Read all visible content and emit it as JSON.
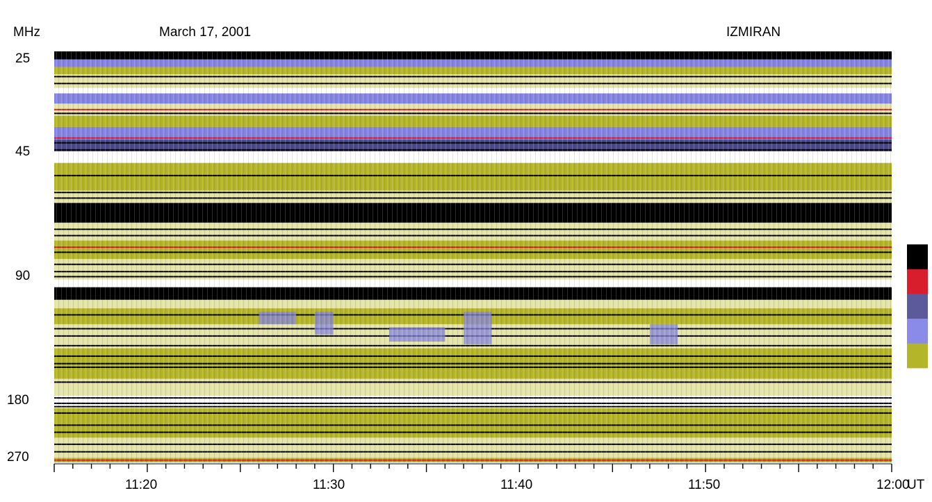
{
  "chart_data": {
    "type": "heatmap",
    "subtype": "radio-spectrogram",
    "date": "March 17, 2001",
    "observatory": "IZMIRAN",
    "ylabel": "MHz",
    "xlabel": "UT",
    "y_ticks": [
      "25",
      "45",
      "90",
      "180",
      "270"
    ],
    "x_ticks": [
      "11:20",
      "11:30",
      "11:40",
      "11:50",
      "12:00"
    ],
    "y_scale": "log",
    "y_range_mhz": [
      25,
      270
    ],
    "x_range": [
      "11:15",
      "12:00"
    ],
    "colorbar_colors": [
      "#000000",
      "#d81e2c",
      "#5c5a9a",
      "#8a8ae8",
      "#b5b52a",
      "#ffffff"
    ],
    "palette": {
      "black": "#000000",
      "red": "#d81e2c",
      "dark_blue": "#4c4a8a",
      "blue": "#8484e2",
      "olive": "#b5b52a",
      "light_yellow": "#e4e3a8",
      "white": "#ffffff"
    },
    "bands": [
      {
        "from_mhz": 25,
        "to_mhz": 26.2,
        "level": "black"
      },
      {
        "from_mhz": 26.2,
        "to_mhz": 27.4,
        "level": "blue"
      },
      {
        "from_mhz": 27.4,
        "to_mhz": 28.6,
        "level": "olive"
      },
      {
        "from_mhz": 28.6,
        "to_mhz": 31.0,
        "level": "light_yellow"
      },
      {
        "from_mhz": 31.0,
        "to_mhz": 32.0,
        "level": "white"
      },
      {
        "from_mhz": 32.0,
        "to_mhz": 34.0,
        "level": "blue"
      },
      {
        "from_mhz": 34.0,
        "to_mhz": 36.5,
        "level": "light_yellow"
      },
      {
        "from_mhz": 36.5,
        "to_mhz": 39.0,
        "level": "olive"
      },
      {
        "from_mhz": 39.0,
        "to_mhz": 42.0,
        "level": "blue"
      },
      {
        "from_mhz": 42.0,
        "to_mhz": 45.0,
        "level": "dark_blue"
      },
      {
        "from_mhz": 45.0,
        "to_mhz": 48.0,
        "level": "white"
      },
      {
        "from_mhz": 48.0,
        "to_mhz": 56.0,
        "level": "olive"
      },
      {
        "from_mhz": 56.0,
        "to_mhz": 60.0,
        "level": "light_yellow"
      },
      {
        "from_mhz": 60.0,
        "to_mhz": 67.0,
        "level": "black"
      },
      {
        "from_mhz": 67.0,
        "to_mhz": 74.0,
        "level": "light_yellow"
      },
      {
        "from_mhz": 74.0,
        "to_mhz": 82.0,
        "level": "olive"
      },
      {
        "from_mhz": 82.0,
        "to_mhz": 92.0,
        "level": "light_yellow"
      },
      {
        "from_mhz": 92.0,
        "to_mhz": 96.0,
        "level": "white"
      },
      {
        "from_mhz": 96.0,
        "to_mhz": 103.0,
        "level": "black"
      },
      {
        "from_mhz": 103.0,
        "to_mhz": 108.0,
        "level": "light_yellow"
      },
      {
        "from_mhz": 108.0,
        "to_mhz": 118.0,
        "level": "olive"
      },
      {
        "from_mhz": 118.0,
        "to_mhz": 135.0,
        "level": "light_yellow"
      },
      {
        "from_mhz": 135.0,
        "to_mhz": 160.0,
        "level": "olive"
      },
      {
        "from_mhz": 160.0,
        "to_mhz": 176.0,
        "level": "light_yellow"
      },
      {
        "from_mhz": 176.0,
        "to_mhz": 190.0,
        "level": "white"
      },
      {
        "from_mhz": 190.0,
        "to_mhz": 230.0,
        "level": "olive"
      },
      {
        "from_mhz": 230.0,
        "to_mhz": 262.0,
        "level": "light_yellow"
      },
      {
        "from_mhz": 262.0,
        "to_mhz": 270.0,
        "level": "olive"
      }
    ],
    "lines": [
      {
        "mhz": 29.0,
        "level": "black"
      },
      {
        "mhz": 30.2,
        "level": "black"
      },
      {
        "mhz": 35.2,
        "level": "red"
      },
      {
        "mhz": 36.0,
        "level": "black"
      },
      {
        "mhz": 41.6,
        "level": "red"
      },
      {
        "mhz": 42.8,
        "level": "black"
      },
      {
        "mhz": 44.6,
        "level": "black"
      },
      {
        "mhz": 51.5,
        "level": "black"
      },
      {
        "mhz": 56.6,
        "level": "black"
      },
      {
        "mhz": 58.4,
        "level": "black"
      },
      {
        "mhz": 69.5,
        "level": "black"
      },
      {
        "mhz": 72.0,
        "level": "black"
      },
      {
        "mhz": 76.8,
        "level": "red"
      },
      {
        "mhz": 79.0,
        "level": "black"
      },
      {
        "mhz": 84.5,
        "level": "black"
      },
      {
        "mhz": 88.0,
        "level": "black"
      },
      {
        "mhz": 90.5,
        "level": "black"
      },
      {
        "mhz": 112.0,
        "level": "black"
      },
      {
        "mhz": 121.0,
        "level": "black"
      },
      {
        "mhz": 126.0,
        "level": "black"
      },
      {
        "mhz": 133.0,
        "level": "black"
      },
      {
        "mhz": 141.0,
        "level": "black"
      },
      {
        "mhz": 147.0,
        "level": "black"
      },
      {
        "mhz": 150.0,
        "level": "black"
      },
      {
        "mhz": 163.0,
        "level": "black"
      },
      {
        "mhz": 178.0,
        "level": "black"
      },
      {
        "mhz": 184.0,
        "level": "black"
      },
      {
        "mhz": 188.0,
        "level": "black"
      },
      {
        "mhz": 196.0,
        "level": "black"
      },
      {
        "mhz": 212.0,
        "level": "black"
      },
      {
        "mhz": 222.0,
        "level": "black"
      },
      {
        "mhz": 240.0,
        "level": "black"
      },
      {
        "mhz": 252.0,
        "level": "black"
      },
      {
        "mhz": 266.0,
        "level": "red"
      }
    ],
    "bursts": [
      {
        "time": "11:26",
        "to": "11:28",
        "from_mhz": 110,
        "to_mhz": 118,
        "level": "blue"
      },
      {
        "time": "11:29",
        "to": "11:30",
        "from_mhz": 110,
        "to_mhz": 125,
        "level": "blue"
      },
      {
        "time": "11:33",
        "to": "11:36",
        "from_mhz": 120,
        "to_mhz": 130,
        "level": "blue"
      },
      {
        "time": "11:37",
        "to": "11:38.5",
        "from_mhz": 110,
        "to_mhz": 132,
        "level": "blue"
      },
      {
        "time": "11:47",
        "to": "11:48.5",
        "from_mhz": 118,
        "to_mhz": 132,
        "level": "blue"
      }
    ]
  }
}
